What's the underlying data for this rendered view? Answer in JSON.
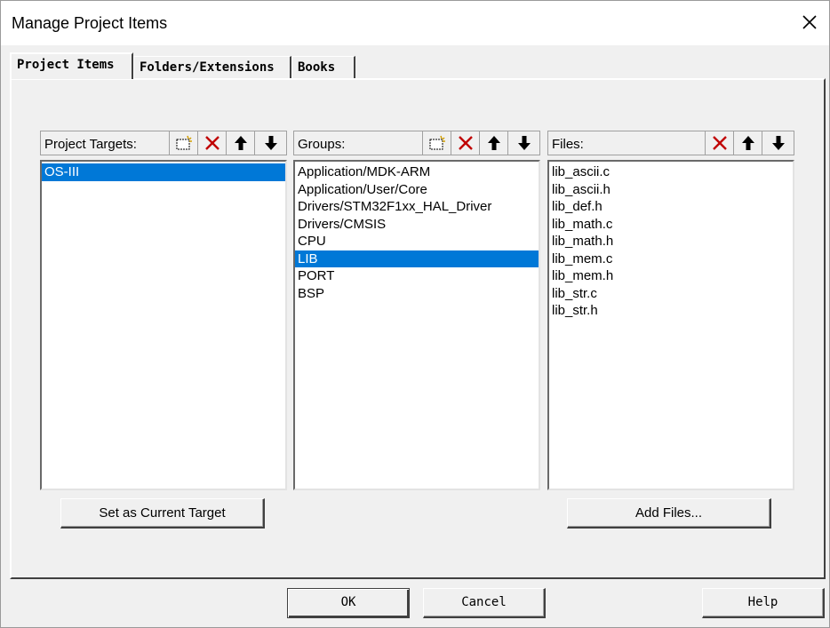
{
  "window": {
    "title": "Manage Project Items"
  },
  "tabs": [
    {
      "label": "Project Items",
      "active": true
    },
    {
      "label": "Folders/Extensions",
      "active": false
    },
    {
      "label": "Books",
      "active": false
    }
  ],
  "targets": {
    "label": "Project Targets:",
    "items": [
      "OS-III"
    ],
    "selected_index": 0
  },
  "groups": {
    "label": "Groups:",
    "items": [
      "Application/MDK-ARM",
      "Application/User/Core",
      "Drivers/STM32F1xx_HAL_Driver",
      "Drivers/CMSIS",
      "CPU",
      "LIB",
      "PORT",
      "BSP"
    ],
    "selected_index": 5
  },
  "files": {
    "label": "Files:",
    "items": [
      "lib_ascii.c",
      "lib_ascii.h",
      "lib_def.h",
      "lib_math.c",
      "lib_math.h",
      "lib_mem.c",
      "lib_mem.h",
      "lib_str.c",
      "lib_str.h"
    ]
  },
  "buttons": {
    "set_current_target": "Set as Current Target",
    "add_files": "Add Files...",
    "ok": "OK",
    "cancel": "Cancel",
    "help": "Help"
  },
  "icons": {
    "new": "new-item-icon",
    "delete": "delete-icon",
    "move_up": "arrow-up-icon",
    "move_down": "arrow-down-icon",
    "close": "close-icon"
  },
  "colors": {
    "selection": "#0078d7",
    "delete_red": "#c00000"
  }
}
